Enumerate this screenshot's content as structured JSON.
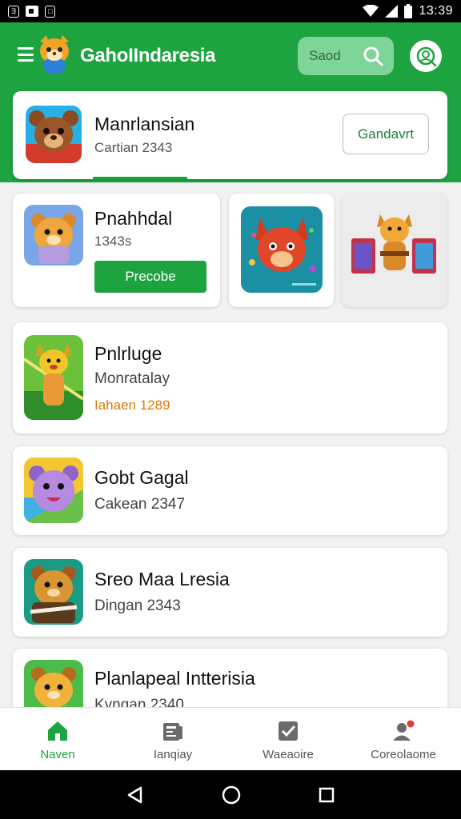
{
  "status_bar": {
    "chip1": "Ǝ",
    "time": "13:39"
  },
  "header": {
    "app_title": "GahoIIndaresia",
    "search_placeholder": "Saod",
    "accent_color": "#1ea341"
  },
  "featured": {
    "title": "Manrlansian",
    "subtitle": "Cartian 2343",
    "button_label": "Gandavrt"
  },
  "grid": {
    "card1": {
      "title": "Pnahhdal",
      "subtitle": "1343s",
      "button_label": "Precobe"
    }
  },
  "list": [
    {
      "title": "Pnlrluge",
      "subtitle": "Monratalay",
      "accent": "Iahaen 1289"
    },
    {
      "title": "Gobt Gagal",
      "subtitle": "Cakean 2347"
    },
    {
      "title": "Sreo Maa Lresia",
      "subtitle": "Dingan 2343"
    },
    {
      "title": "Planlapeal Intterisia",
      "subtitle": "Kyngan 2340"
    }
  ],
  "bottom_nav": [
    {
      "label": "Naven",
      "icon": "home-icon"
    },
    {
      "label": "Ianqiay",
      "icon": "news-icon"
    },
    {
      "label": "Waeaoire",
      "icon": "checkbox-icon"
    },
    {
      "label": "Coreolaome",
      "icon": "profile-icon"
    }
  ]
}
